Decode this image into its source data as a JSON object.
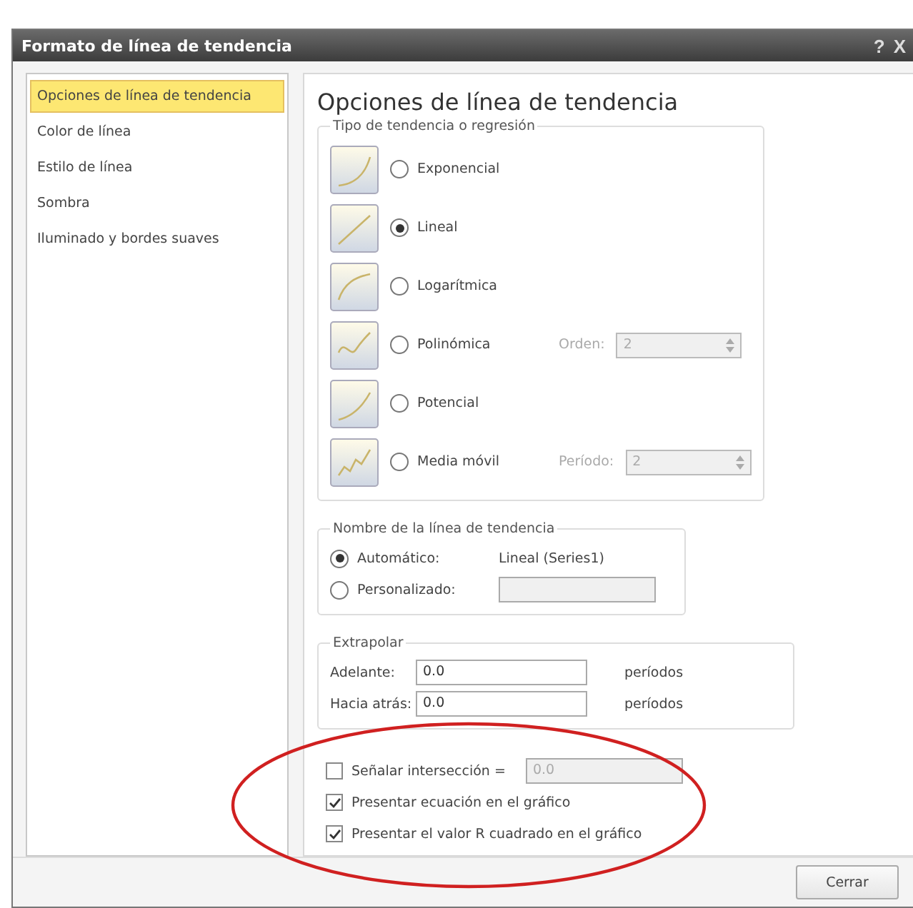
{
  "window": {
    "title": "Formato de línea de tendencia",
    "buttons": [
      "?",
      "X"
    ]
  },
  "sidebar": {
    "items": [
      {
        "label": "Opciones de línea de tendencia",
        "selected": true
      },
      {
        "label": "Color de línea",
        "selected": false
      },
      {
        "label": "Estilo de línea",
        "selected": false
      },
      {
        "label": "Sombra",
        "selected": false
      },
      {
        "label": "Iluminado y bordes suaves",
        "selected": false
      }
    ]
  },
  "heading": "Opciones de línea de tendencia",
  "trend_type": {
    "legend": "Tipo de tendencia o regresión",
    "options": [
      {
        "label": "Exponencial",
        "selected": false
      },
      {
        "label": "Lineal",
        "selected": true
      },
      {
        "label": "Logarítmica",
        "selected": false
      },
      {
        "label": "Polinómica",
        "selected": false,
        "param": {
          "label": "Orden:",
          "value": "2",
          "disabled": true
        }
      },
      {
        "label": "Potencial",
        "selected": false
      },
      {
        "label": "Media móvil",
        "selected": false,
        "param": {
          "label": "Período:",
          "value": "2",
          "disabled": true
        }
      }
    ]
  },
  "trend_name": {
    "legend": "Nombre de la línea de tendencia",
    "options": [
      {
        "label": "Automático:",
        "selected": true,
        "value": "Lineal (Series1)"
      },
      {
        "label": "Personalizado:",
        "selected": false,
        "field_disabled": true
      }
    ]
  },
  "extrapolate": {
    "legend": "Extrapolar",
    "rows": [
      {
        "label": "Adelante:",
        "value": "0.0",
        "unit": "períodos"
      },
      {
        "label": "Hacia atrás:",
        "value": "0.0",
        "unit": "períodos"
      }
    ]
  },
  "checks": [
    {
      "label": "Señalar intersección =",
      "checked": false,
      "field": {
        "value": "0.0",
        "disabled": true
      }
    },
    {
      "label": "Presentar ecuación en el gráfico",
      "checked": true
    },
    {
      "label": "Presentar el valor R cuadrado en el gráfico",
      "checked": true
    }
  ],
  "close_button": "Cerrar"
}
